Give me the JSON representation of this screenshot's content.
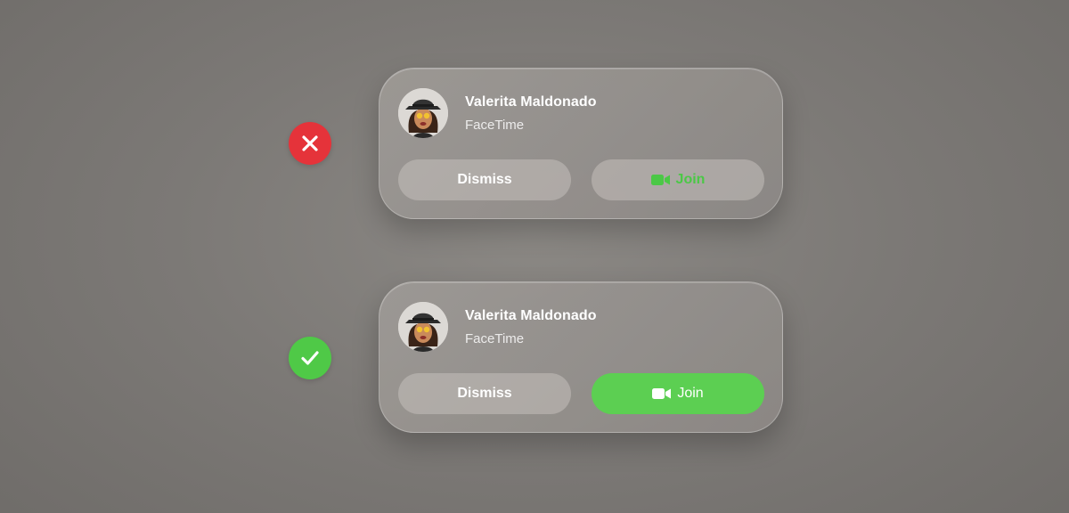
{
  "examples": [
    {
      "verdict": "incorrect",
      "marker_icon": "x-mark-icon",
      "marker_color": "#e5333a",
      "caller": {
        "name": "Valerita Maldonado",
        "app": "FaceTime"
      },
      "dismiss_label": "Dismiss",
      "join_label": "Join",
      "join_style": {
        "background": "#c4c0bc",
        "text_color": "#4bc846"
      }
    },
    {
      "verdict": "correct",
      "marker_icon": "checkmark-icon",
      "marker_color": "#4fc947",
      "caller": {
        "name": "Valerita Maldonado",
        "app": "FaceTime"
      },
      "dismiss_label": "Dismiss",
      "join_label": "Join",
      "join_style": {
        "background": "#5ccf52",
        "text_color": "#ffffff"
      }
    }
  ],
  "icons": {
    "avatar": "memoji-avatar-icon",
    "join": "video-camera-icon"
  }
}
